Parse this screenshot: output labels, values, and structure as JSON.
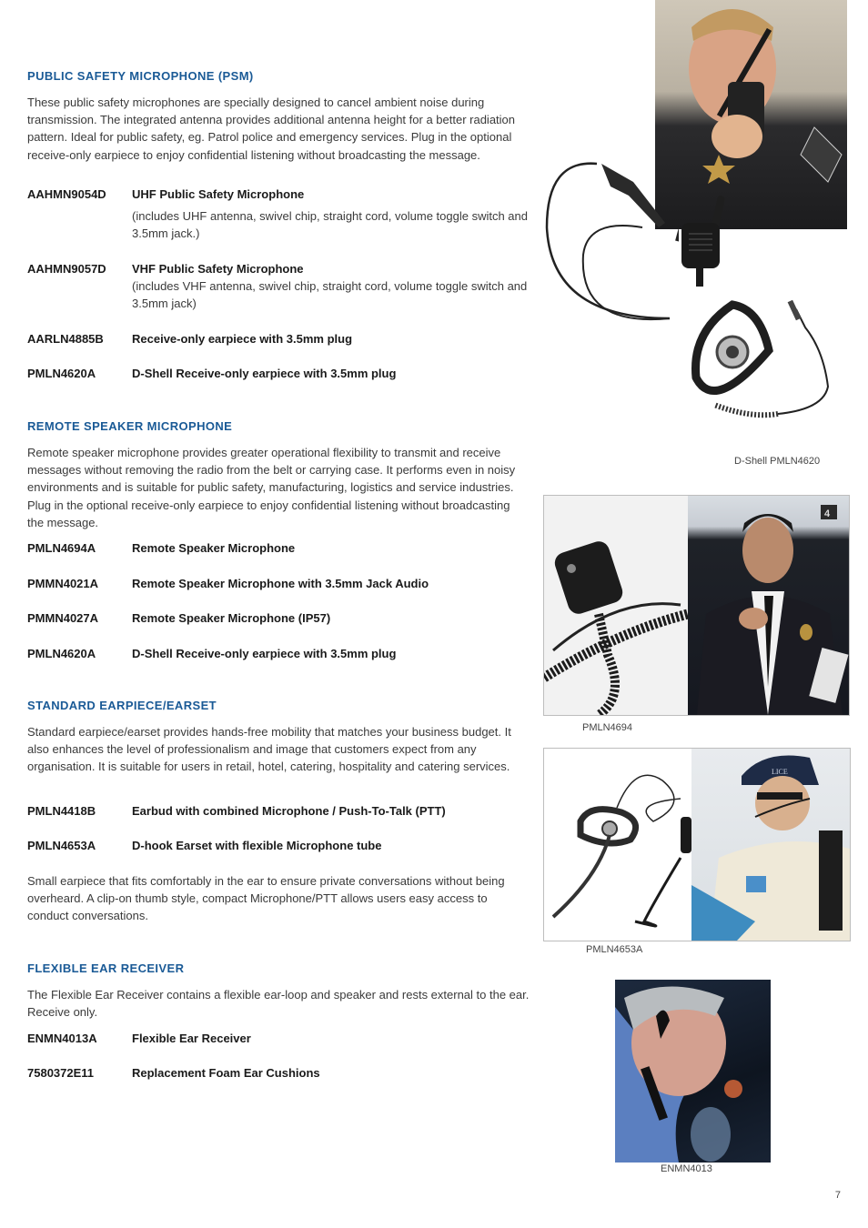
{
  "sections": [
    {
      "title": "PUBLIC SAFETY MICROPHONE (PSM)",
      "intro": "These public safety microphones are specially designed to cancel ambient noise during transmission. The integrated antenna provides additional antenna height for a better radiation pattern. Ideal for public safety, eg. Patrol police and emergency services. Plug in the optional receive-only earpiece to enjoy confidential listening without broadcasting the message.",
      "items": [
        {
          "code": "AAHMN9054D",
          "name": "UHF Public Safety Microphone",
          "note": "(includes UHF antenna, swivel chip, straight cord, volume toggle switch and 3.5mm jack.)"
        },
        {
          "code": "AAHMN9057D",
          "name": "VHF Public Safety Microphone",
          "note": "(includes VHF antenna, swivel chip, straight cord, volume toggle switch and 3.5mm jack)"
        },
        {
          "code": "AARLN4885B",
          "name": "Receive-only earpiece with 3.5mm plug"
        },
        {
          "code": "PMLN4620A",
          "name": "D-Shell Receive-only earpiece with 3.5mm plug"
        }
      ]
    },
    {
      "title": "REMOTE SPEAKER MICROPHONE",
      "intro": "Remote speaker microphone provides greater operational flexibility to transmit and receive messages without removing the radio from the belt or carrying case. It performs even in noisy environments and is suitable for public safety, manufacturing, logistics and service industries. Plug in the optional receive-only earpiece to enjoy confidential listening without broadcasting the message.",
      "items": [
        {
          "code": "PMLN4694A",
          "name": "Remote Speaker Microphone"
        },
        {
          "code": "PMMN4021A",
          "name": "Remote Speaker Microphone with 3.5mm Jack Audio"
        },
        {
          "code": "PMMN4027A",
          "name": "Remote Speaker Microphone (IP57)"
        },
        {
          "code": "PMLN4620A",
          "name": "D-Shell Receive-only earpiece with 3.5mm plug"
        }
      ]
    },
    {
      "title": "STANDARD EARPIECE/EARSET",
      "intro": "Standard earpiece/earset provides hands-free mobility that matches your business budget. It also enhances the level of professionalism and image that customers expect from any organisation. It is suitable for users in retail, hotel, catering, hospitality and catering services.",
      "items": [
        {
          "code": "PMLN4418B",
          "name": "Earbud with combined Microphone / Push-To-Talk (PTT)"
        },
        {
          "code": "PMLN4653A",
          "name": "D-hook Earset with flexible Microphone tube"
        }
      ],
      "outro": "Small earpiece that fits comfortably in the ear to ensure private conversations without being overheard.  A clip-on thumb style, compact Microphone/PTT allows users easy access to conduct conversations."
    },
    {
      "title": "FLEXIBLE EAR RECEIVER",
      "intro": "The Flexible Ear Receiver contains a flexible ear-loop and speaker and rests external to the ear. Receive only.",
      "items": [
        {
          "code": "ENMN4013A",
          "name": "Flexible Ear Receiver"
        },
        {
          "code": "7580372E11",
          "name": "Replacement Foam Ear Cushions"
        }
      ]
    }
  ],
  "captions": {
    "dshell": "D-Shell PMLN4620",
    "rsm": "PMLN4694",
    "earset": "PMLN4653A",
    "receiver": "ENMN4013"
  },
  "page_number": "7"
}
